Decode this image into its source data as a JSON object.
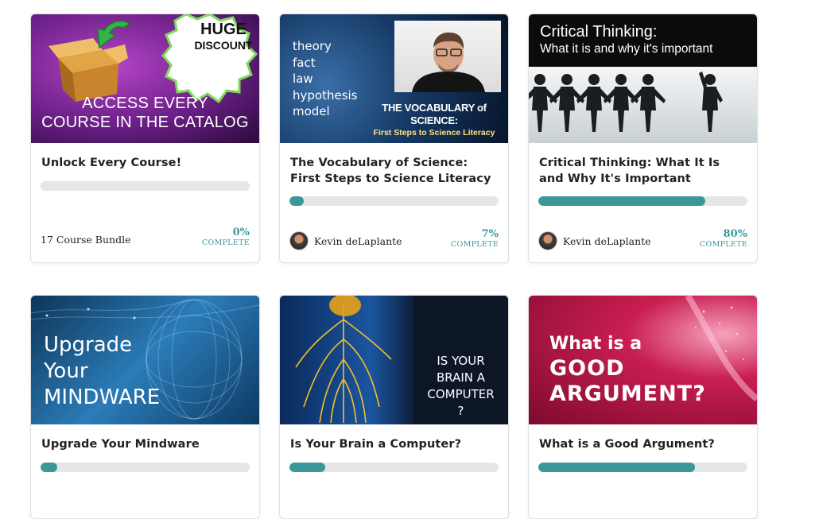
{
  "courses": [
    {
      "title": "Unlock Every Course!",
      "thumb_lines": [
        "ACCESS EVERY",
        "COURSE IN THE CATALOG"
      ],
      "badge": [
        "HUGE",
        "DISCOUNT"
      ],
      "footer_text": "17 Course Bundle",
      "progress": 0,
      "percent": "0%",
      "complete_label": "COMPLETE"
    },
    {
      "title": "The Vocabulary of Science: First Steps to Science Literacy",
      "thumb_words": [
        "theory",
        "fact",
        "law",
        "hypothesis",
        "model"
      ],
      "thumb_heading": "THE VOCABULARY of SCIENCE:",
      "thumb_sub": "First Steps to Science Literacy",
      "author": "Kevin deLaplante",
      "progress": 7,
      "percent": "7%",
      "complete_label": "COMPLETE"
    },
    {
      "title": "Critical Thinking: What It Is and Why It's Important",
      "thumb_heading": "Critical Thinking:",
      "thumb_sub": "What it is and why it's important",
      "author": "Kevin deLaplante",
      "progress": 80,
      "percent": "80%",
      "complete_label": "COMPLETE"
    },
    {
      "title": "Upgrade Your Mindware",
      "thumb_lines": [
        "Upgrade",
        "Your",
        "MINDWARE"
      ],
      "progress": 8
    },
    {
      "title": "Is Your Brain a Computer?",
      "thumb_lines": [
        "IS YOUR",
        "BRAIN A",
        "COMPUTER",
        "?"
      ],
      "progress": 17
    },
    {
      "title": "What is a Good Argument?",
      "thumb_lines": [
        "What is a",
        "GOOD",
        "ARGUMENT?"
      ],
      "progress": 75
    }
  ],
  "colors": {
    "accent": "#3a9898",
    "track": "#e6e6e6",
    "title": "#222222"
  }
}
